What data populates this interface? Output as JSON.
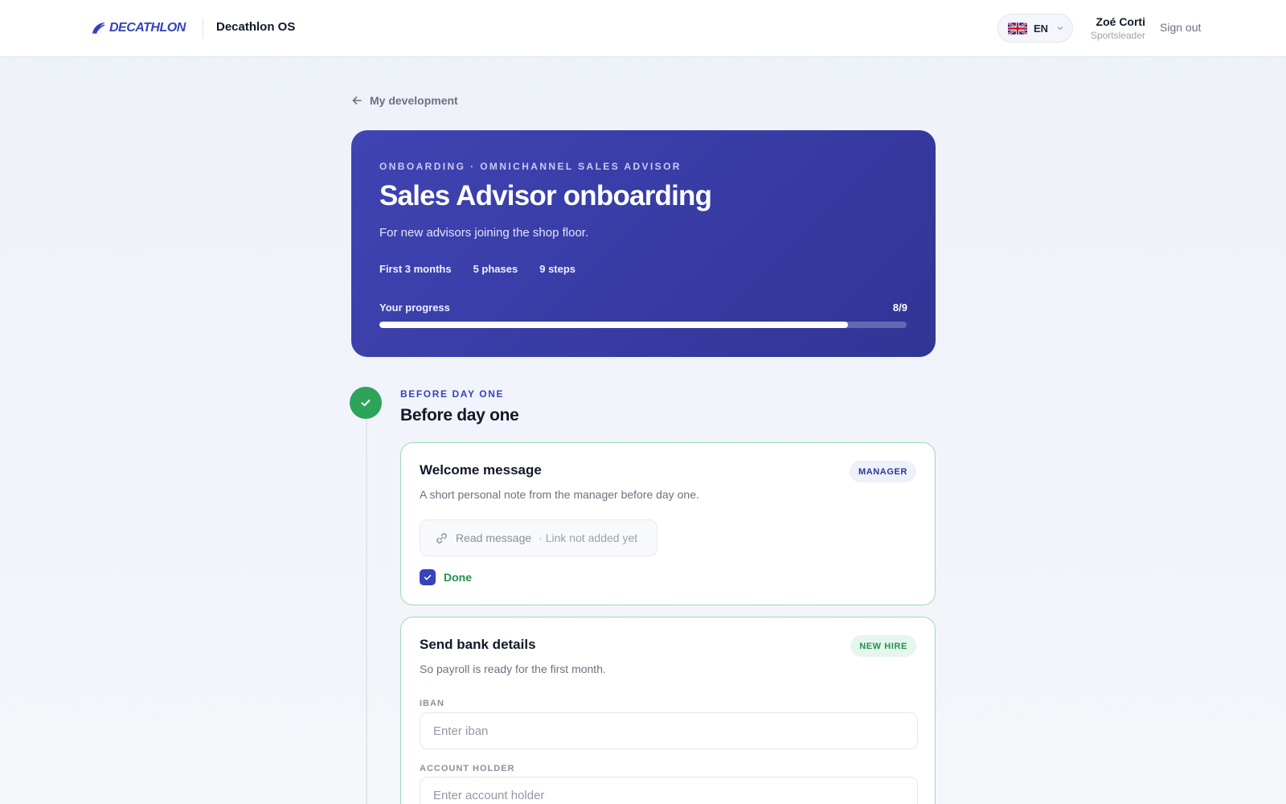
{
  "header": {
    "brand": "DECATHLON",
    "app_name": "Decathlon OS",
    "language": "EN",
    "user_name": "Zoé Corti",
    "user_role": "Sportsleader",
    "sign_out": "Sign out"
  },
  "nav": {
    "back_label": "My development"
  },
  "hero": {
    "eyebrow": "ONBOARDING · OMNICHANNEL SALES ADVISOR",
    "title": "Sales Advisor onboarding",
    "subtitle": "For new advisors joining the shop floor.",
    "meta": [
      "First 3 months",
      "5 phases",
      "9 steps"
    ],
    "progress_label": "Your progress",
    "progress_text": "8/9",
    "progress_fraction": 0.889
  },
  "phase": {
    "eyebrow": "BEFORE DAY ONE",
    "title": "Before day one"
  },
  "cards": [
    {
      "title": "Welcome message",
      "badge": "MANAGER",
      "description": "A short personal note from the manager before day one.",
      "link_label": "Read message",
      "link_note": "· Link not added yet",
      "done_label": "Done"
    },
    {
      "title": "Send bank details",
      "badge": "NEW HIRE",
      "description": "So payroll is ready for the first month.",
      "fields": [
        {
          "label": "IBAN",
          "placeholder": "Enter iban",
          "value": ""
        },
        {
          "label": "ACCOUNT HOLDER",
          "placeholder": "Enter account holder",
          "value": ""
        }
      ]
    }
  ],
  "colors": {
    "brand": "#3643ba",
    "success": "#2ea35a",
    "hero_start": "#4044b3",
    "hero_end": "#313595"
  }
}
